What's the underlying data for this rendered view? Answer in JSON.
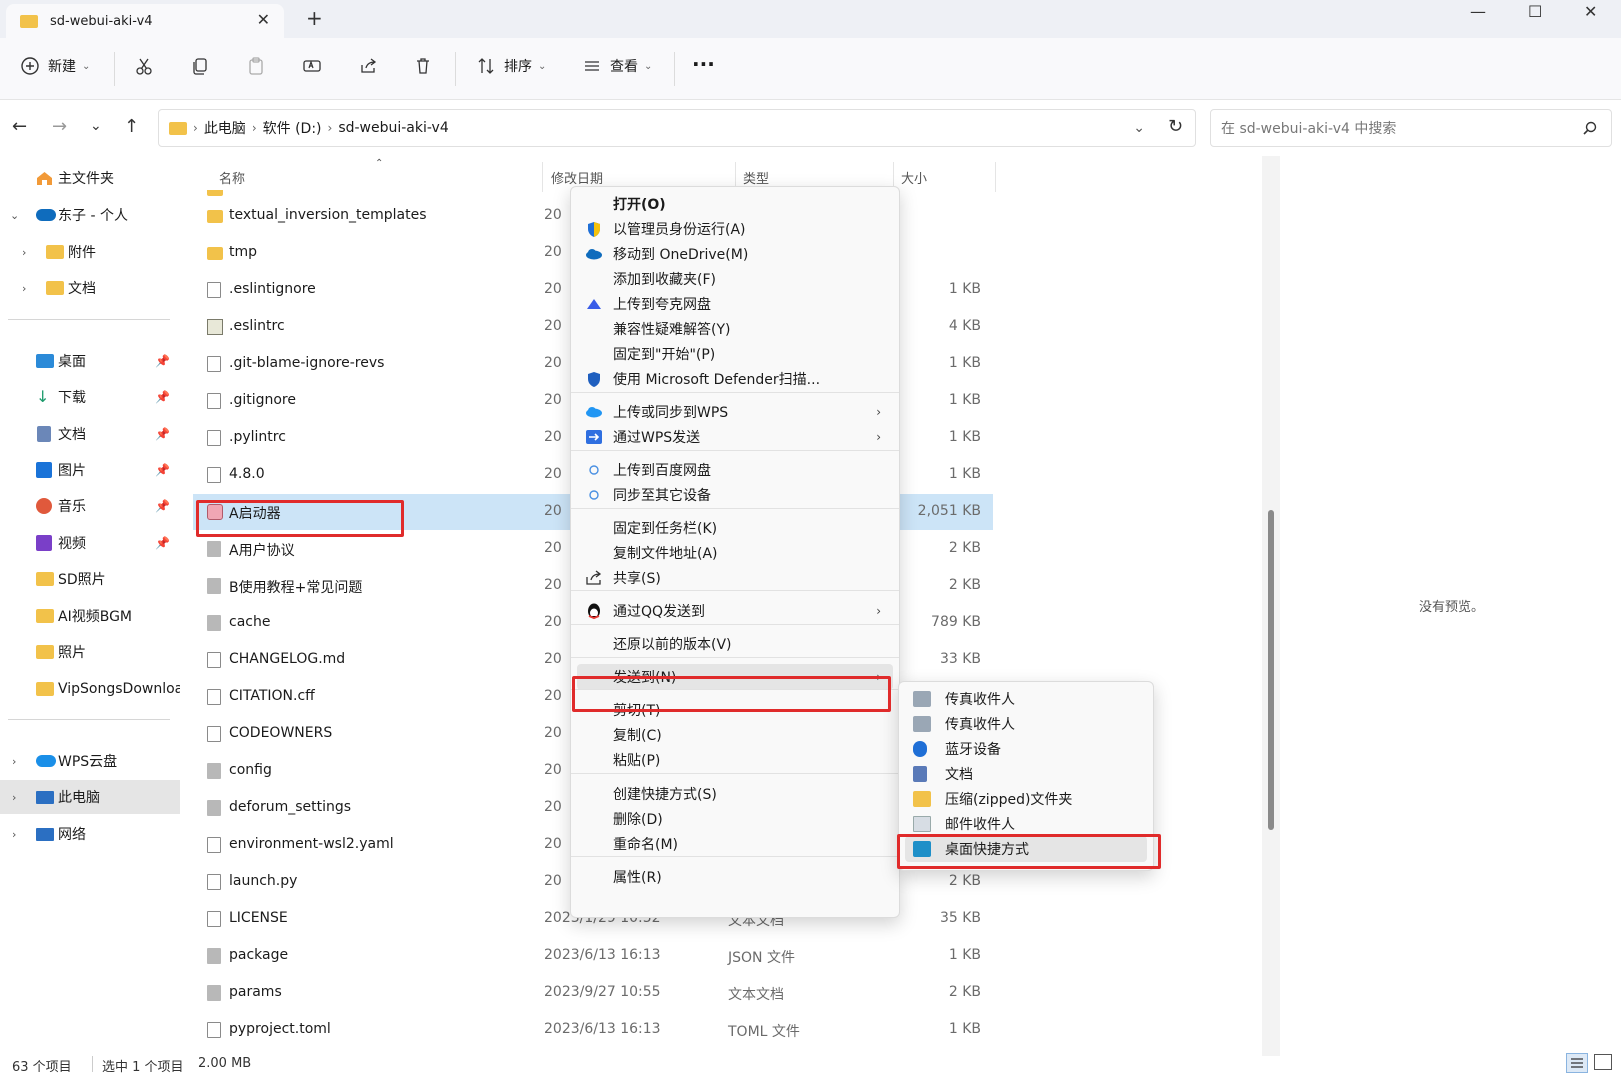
{
  "window": {
    "tab_title": "sd-webui-aki-v4",
    "tab_close": "✕",
    "new_tab": "+",
    "minimize": "—",
    "maximize": "☐",
    "close": "✕"
  },
  "toolbar": {
    "new_label": "新建",
    "sort_label": "排序",
    "view_label": "查看",
    "more_label": "···"
  },
  "address": {
    "crumbs": [
      "此电脑",
      "软件 (D:)",
      "sd-webui-aki-v4"
    ],
    "search_placeholder": "在 sd-webui-aki-v4 中搜索"
  },
  "sidebar": {
    "items": [
      {
        "label": "主文件夹"
      },
      {
        "label": "东子 - 个人"
      },
      {
        "label": "附件"
      },
      {
        "label": "文档"
      },
      {
        "label": "桌面"
      },
      {
        "label": "下载"
      },
      {
        "label": "文档"
      },
      {
        "label": "图片"
      },
      {
        "label": "音乐"
      },
      {
        "label": "视频"
      },
      {
        "label": "SD照片"
      },
      {
        "label": "AI视频BGM"
      },
      {
        "label": "照片"
      },
      {
        "label": "VipSongsDownload"
      },
      {
        "label": "WPS云盘"
      },
      {
        "label": "此电脑"
      },
      {
        "label": "网络"
      }
    ]
  },
  "columns": {
    "name": "名称",
    "date": "修改日期",
    "type": "类型",
    "size": "大小"
  },
  "files": [
    {
      "name": "textual_inversion_templates",
      "date": "20",
      "type": "",
      "size": "",
      "icon": "folder"
    },
    {
      "name": "tmp",
      "date": "20",
      "type": "",
      "size": "",
      "icon": "folder"
    },
    {
      "name": ".eslintignore",
      "date": "20",
      "type": "",
      "size": "1 KB",
      "icon": "doc"
    },
    {
      "name": ".eslintrc",
      "date": "20",
      "type": "",
      "size": "4 KB",
      "icon": "script"
    },
    {
      "name": ".git-blame-ignore-revs",
      "date": "20",
      "type": "",
      "size": "1 KB",
      "icon": "doc"
    },
    {
      "name": ".gitignore",
      "date": "20",
      "type": "",
      "size": "1 KB",
      "icon": "doc"
    },
    {
      "name": ".pylintrc",
      "date": "20",
      "type": "",
      "size": "1 KB",
      "icon": "doc"
    },
    {
      "name": "4.8.0",
      "date": "20",
      "type": "",
      "size": "1 KB",
      "icon": "doc"
    },
    {
      "name": "A启动器",
      "date": "20",
      "type": "",
      "size": "2,051 KB",
      "icon": "app"
    },
    {
      "name": "A用户协议",
      "date": "20",
      "type": "",
      "size": "2 KB",
      "icon": "gray"
    },
    {
      "name": "B使用教程+常见问题",
      "date": "20",
      "type": "",
      "size": "2 KB",
      "icon": "gray"
    },
    {
      "name": "cache",
      "date": "20",
      "type": "",
      "size": "789 KB",
      "icon": "gray"
    },
    {
      "name": "CHANGELOG.md",
      "date": "20",
      "type": "",
      "size": "33 KB",
      "icon": "doc"
    },
    {
      "name": "CITATION.cff",
      "date": "20",
      "type": "",
      "size": "",
      "icon": "doc"
    },
    {
      "name": "CODEOWNERS",
      "date": "20",
      "type": "",
      "size": "",
      "icon": "doc"
    },
    {
      "name": "config",
      "date": "20",
      "type": "",
      "size": "",
      "icon": "gray"
    },
    {
      "name": "deforum_settings",
      "date": "20",
      "type": "",
      "size": "",
      "icon": "gray"
    },
    {
      "name": "environment-wsl2.yaml",
      "date": "20",
      "type": "",
      "size": "",
      "icon": "doc"
    },
    {
      "name": "launch.py",
      "date": "20",
      "type": "",
      "size": "2 KB",
      "icon": "doc"
    },
    {
      "name": "LICENSE",
      "date": "2023/1/29 10:52",
      "type": "文本文档",
      "size": "35 KB",
      "icon": "doc"
    },
    {
      "name": "package",
      "date": "2023/6/13 16:13",
      "type": "JSON 文件",
      "size": "1 KB",
      "icon": "gray"
    },
    {
      "name": "params",
      "date": "2023/9/27 10:55",
      "type": "文本文档",
      "size": "2 KB",
      "icon": "gray"
    },
    {
      "name": "pyproject.toml",
      "date": "2023/6/13 16:13",
      "type": "TOML 文件",
      "size": "1 KB",
      "icon": "doc"
    }
  ],
  "context_menu": {
    "items": [
      {
        "label": "打开(O)",
        "icon": ""
      },
      {
        "label": "以管理员身份运行(A)",
        "icon": "shield"
      },
      {
        "label": "移动到 OneDrive(M)",
        "icon": "cloud"
      },
      {
        "label": "添加到收藏夹(F)",
        "icon": ""
      },
      {
        "label": "上传到夸克网盘",
        "icon": "quark"
      },
      {
        "label": "兼容性疑难解答(Y)",
        "icon": ""
      },
      {
        "label": "固定到\"开始\"(P)",
        "icon": ""
      },
      {
        "label": "使用 Microsoft Defender扫描...",
        "icon": "defender"
      },
      {
        "label": "上传或同步到WPS",
        "icon": "wpscloud"
      },
      {
        "label": "通过WPS发送",
        "icon": "wpssend"
      },
      {
        "label": "上传到百度网盘",
        "icon": "baidu"
      },
      {
        "label": "同步至其它设备",
        "icon": "baidu"
      },
      {
        "label": "固定到任务栏(K)",
        "icon": ""
      },
      {
        "label": "复制文件地址(A)",
        "icon": ""
      },
      {
        "label": "共享(S)",
        "icon": "share"
      },
      {
        "label": "通过QQ发送到",
        "icon": "qq"
      },
      {
        "label": "还原以前的版本(V)",
        "icon": ""
      },
      {
        "label": "发送到(N)",
        "icon": ""
      },
      {
        "label": "剪切(T)",
        "icon": ""
      },
      {
        "label": "复制(C)",
        "icon": ""
      },
      {
        "label": "粘贴(P)",
        "icon": ""
      },
      {
        "label": "创建快捷方式(S)",
        "icon": ""
      },
      {
        "label": "删除(D)",
        "icon": ""
      },
      {
        "label": "重命名(M)",
        "icon": ""
      },
      {
        "label": "属性(R)",
        "icon": ""
      }
    ]
  },
  "send_to_menu": {
    "items": [
      {
        "label": "传真收件人"
      },
      {
        "label": "传真收件人"
      },
      {
        "label": "蓝牙设备"
      },
      {
        "label": "文档"
      },
      {
        "label": "压缩(zipped)文件夹"
      },
      {
        "label": "邮件收件人"
      },
      {
        "label": "桌面快捷方式"
      }
    ]
  },
  "preview": {
    "message": "没有预览。"
  },
  "status": {
    "item_count": "63 个项目",
    "selection": "选中 1 个项目",
    "selection_size": "2.00 MB"
  },
  "colors": {
    "highlight_red": "#e02b2b",
    "selection_blue": "#cce4f7",
    "folder_yellow": "#f2c24a"
  }
}
